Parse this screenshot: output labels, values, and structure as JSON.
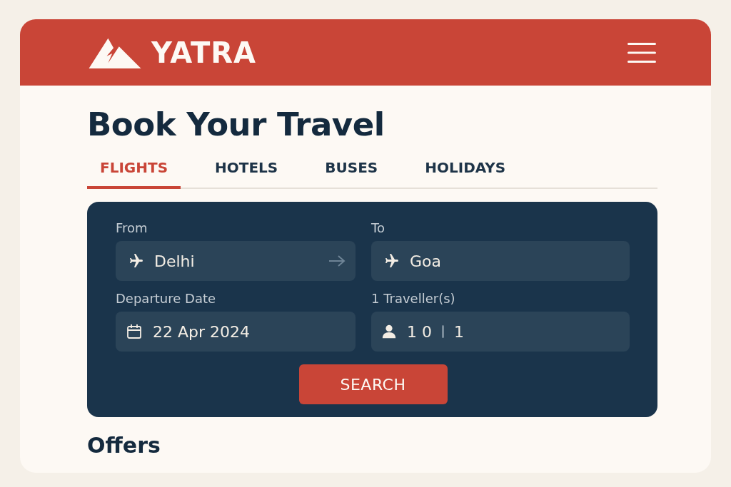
{
  "header": {
    "brand": "YATRA"
  },
  "title": "Book Your Travel",
  "tabs": [
    {
      "label": "FLIGHTS",
      "selected": true
    },
    {
      "label": "HOTELS",
      "selected": false
    },
    {
      "label": "BUSES",
      "selected": false
    },
    {
      "label": "HOLIDAYS",
      "selected": false
    }
  ],
  "form": {
    "fields": [
      {
        "label": "From",
        "value": "Delhi",
        "kind": "origin"
      },
      {
        "label": "To",
        "value": "Goa",
        "kind": "destination"
      },
      {
        "label": "Departure Date",
        "value": "22 Apr 2024",
        "kind": "date"
      },
      {
        "label": "1 Traveller(s)",
        "value": "1 0",
        "value_2": "1",
        "kind": "travellers"
      }
    ],
    "button": "SEARCH"
  },
  "offers": {
    "title": "Offers"
  }
}
